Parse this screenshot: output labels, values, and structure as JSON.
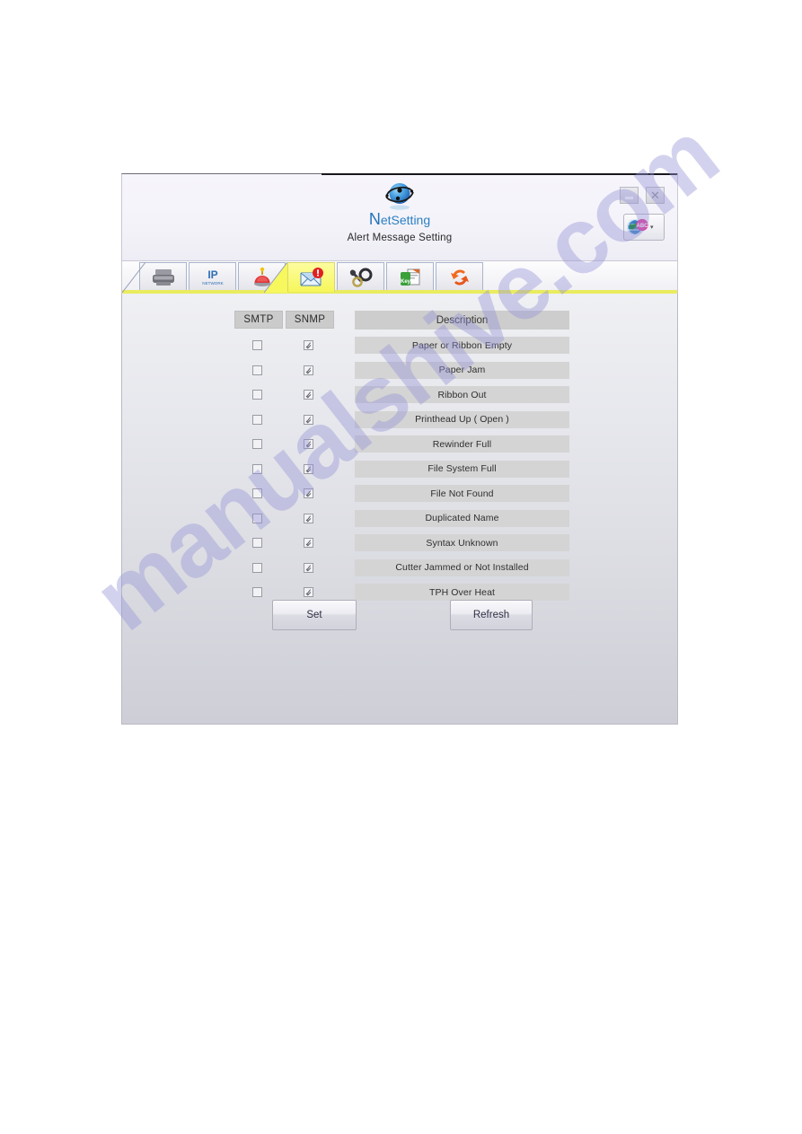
{
  "window": {
    "app_name": "NetSetting",
    "logo_cap": "N",
    "logo_rest": "etSetting",
    "subtitle": "Alert Message Setting",
    "minimize_label": "",
    "close_label": "✕",
    "language_arrow": "▾"
  },
  "tabs": [
    {
      "id": "printer",
      "icon": "printer-icon",
      "active": false
    },
    {
      "id": "ip",
      "icon": "ip-network-icon",
      "active": false
    },
    {
      "id": "alarm",
      "icon": "alarm-bell-icon",
      "active": false
    },
    {
      "id": "alert",
      "icon": "mail-alert-icon",
      "active": true
    },
    {
      "id": "settings",
      "icon": "wrench-gear-icon",
      "active": false
    },
    {
      "id": "security",
      "icon": "key-file-icon",
      "active": false
    },
    {
      "id": "refresh",
      "icon": "refresh-arrows-icon",
      "active": false
    }
  ],
  "table": {
    "headers": {
      "smtp": "SMTP",
      "snmp": "SNMP",
      "description": "Description"
    },
    "rows": [
      {
        "description": "Paper or Ribbon Empty",
        "smtp": false,
        "snmp": true
      },
      {
        "description": "Paper Jam",
        "smtp": false,
        "snmp": true
      },
      {
        "description": "Ribbon Out",
        "smtp": false,
        "snmp": true
      },
      {
        "description": "Printhead Up ( Open )",
        "smtp": false,
        "snmp": true
      },
      {
        "description": "Rewinder Full",
        "smtp": false,
        "snmp": true
      },
      {
        "description": "File System Full",
        "smtp": false,
        "snmp": true
      },
      {
        "description": "File Not Found",
        "smtp": false,
        "snmp": true
      },
      {
        "description": "Duplicated Name",
        "smtp": false,
        "snmp": true
      },
      {
        "description": "Syntax Unknown",
        "smtp": false,
        "snmp": true
      },
      {
        "description": "Cutter Jammed or Not Installed",
        "smtp": false,
        "snmp": true
      },
      {
        "description": "TPH Over Heat",
        "smtp": false,
        "snmp": true
      }
    ]
  },
  "actions": {
    "set_label": "Set",
    "refresh_label": "Refresh"
  },
  "watermark": {
    "text": "manualshive.com"
  },
  "colors": {
    "accent_yellow": "#e9ec5e",
    "logo_blue": "#2b7fc4",
    "header_grey": "#cbcbcb",
    "row_grey": "#d4d4d4",
    "watermark_purple": "#9694d6"
  }
}
